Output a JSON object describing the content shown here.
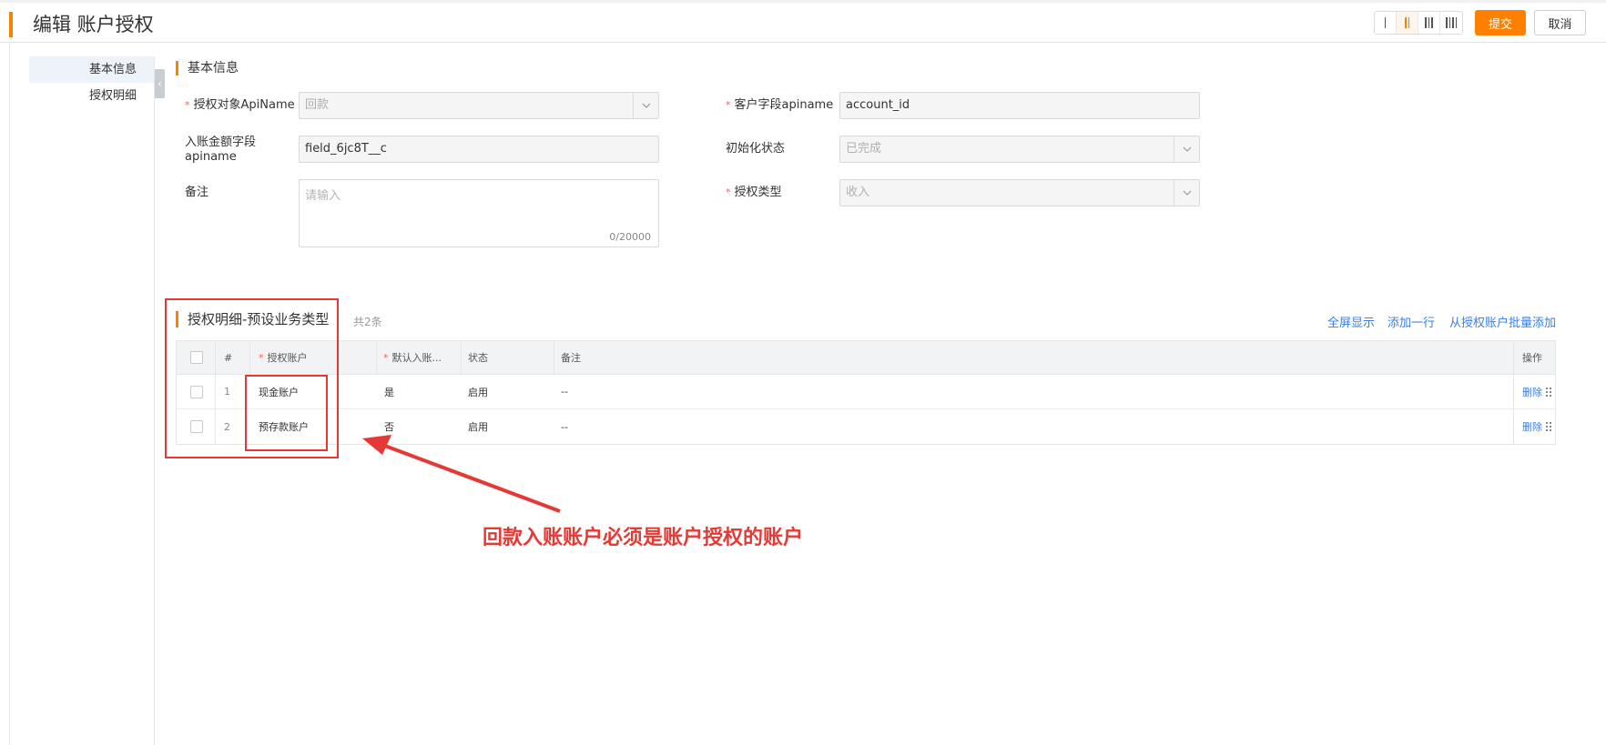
{
  "header": {
    "title": "编辑 账户授权",
    "submit_label": "提交",
    "cancel_label": "取消",
    "layout_options": [
      "1-column",
      "2-column",
      "3-column",
      "4-column"
    ],
    "layout_selected": "2-column",
    "accent_color": "#ff8000"
  },
  "sidebar": {
    "items": [
      {
        "label": "基本信息",
        "active": true
      },
      {
        "label": "授权明细",
        "active": false
      }
    ],
    "collapse_icon": "chevron-left-icon"
  },
  "basic": {
    "section_title": "基本信息",
    "auth_object": {
      "label": "授权对象ApiName",
      "required": true,
      "value": "回款"
    },
    "amount_field": {
      "label_line1": "入账金额字段",
      "label_line2": "apiname",
      "value": "field_6jc8T__c"
    },
    "remark": {
      "label": "备注",
      "placeholder": "请输入",
      "counter": "0/20000"
    },
    "customer_field": {
      "label": "客户字段apiname",
      "required": true,
      "value": "account_id"
    },
    "init_status": {
      "label": "初始化状态",
      "value": "已完成"
    },
    "auth_type": {
      "label": "授权类型",
      "required": true,
      "value": "收入"
    }
  },
  "detail": {
    "title": "授权明细-预设业务类型",
    "count": "共2条",
    "actions": {
      "fullscreen": "全屏显示",
      "add_row": "添加一行",
      "batch_add": "从授权账户批量添加"
    },
    "columns": {
      "index": "#",
      "account": "授权账户",
      "default": "默认入账...",
      "status": "状态",
      "remark": "备注",
      "ops": "操作"
    },
    "rows": [
      {
        "index": "1",
        "account": "现金账户",
        "default": "是",
        "status": "启用",
        "remark": "--",
        "op": "删除"
      },
      {
        "index": "2",
        "account": "预存款账户",
        "default": "否",
        "status": "启用",
        "remark": "--",
        "op": "删除"
      }
    ]
  },
  "annotation": {
    "text": "回款入账账户必须是账户授权的账户",
    "color": "#e53935"
  }
}
